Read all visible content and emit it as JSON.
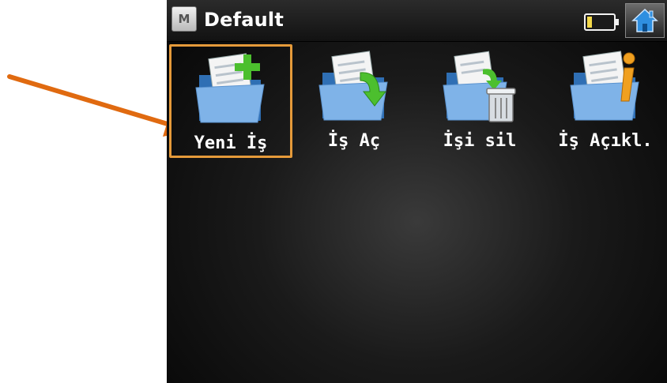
{
  "window": {
    "title": "Default",
    "menu_badge": "M",
    "battery_icon": "battery-icon",
    "home_icon": "home-icon"
  },
  "actions": [
    {
      "label": "Yeni İş",
      "icon": "new-job-folder-icon",
      "selected": true
    },
    {
      "label": "İş Aç",
      "icon": "open-job-folder-icon",
      "selected": false
    },
    {
      "label": "İşi sil",
      "icon": "delete-job-folder-icon",
      "selected": false
    },
    {
      "label": "İş Açıkl.",
      "icon": "job-info-folder-icon",
      "selected": false
    }
  ],
  "colors": {
    "highlight": "#e59a3a",
    "annotation_arrow": "#e06a10",
    "home_accent": "#2f8fe0"
  }
}
